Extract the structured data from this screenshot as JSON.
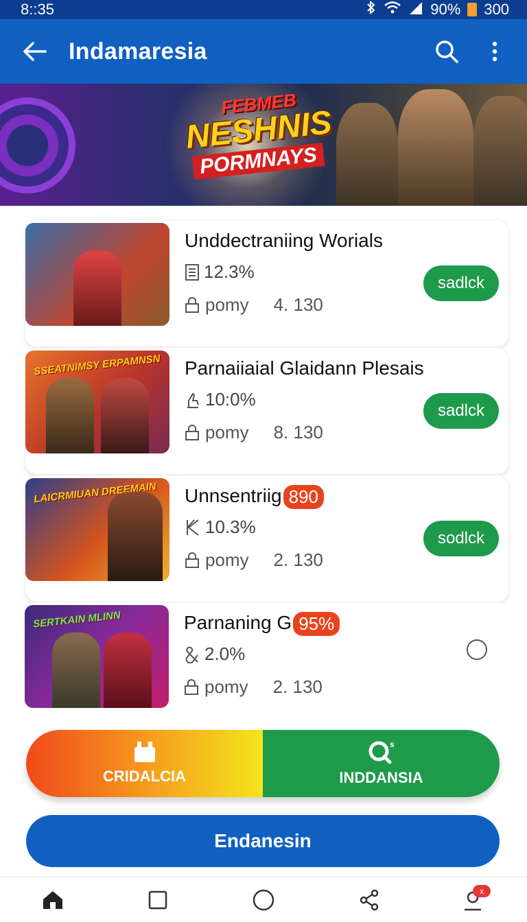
{
  "status_bar": {
    "time": "8::35",
    "battery": "90%",
    "extra": "300"
  },
  "app_bar": {
    "title": "Indamaresia"
  },
  "banner": {
    "line1": "FEBMEB",
    "line2": "NESHNIS",
    "line3": "PORMNAYS"
  },
  "games": [
    {
      "title": "Unddectraniing Worials",
      "badge": "",
      "stat": "12.3%",
      "stat_icon": "document-icon",
      "meta_label": "pomy",
      "meta_value": "4. 130",
      "action": "sadlck",
      "thumb_caption": "",
      "thumb_colors": [
        "#3a6ea8",
        "#c0462f"
      ]
    },
    {
      "title": "Parnaiiaial Glaidann Plesais",
      "badge": "",
      "stat": "10:0%",
      "stat_icon": "hand-icon",
      "meta_label": "pomy",
      "meta_value": "8. 130",
      "action": "sadlck",
      "thumb_caption": "SSEATNIMSY ERPAMNSN",
      "thumb_colors": [
        "#e8732a",
        "#7a2a55"
      ]
    },
    {
      "title": "Unnsentriig",
      "badge": "890",
      "stat": "10.3%",
      "stat_icon": "k-icon",
      "meta_label": "pomy",
      "meta_value": "2. 130",
      "action": "sodlck",
      "thumb_caption": "LAICRMIUAN DREEMAIN",
      "thumb_colors": [
        "#2f3f8a",
        "#d5541e"
      ]
    },
    {
      "title": "Parnaning G",
      "badge": "95%",
      "stat": "2.0%",
      "stat_icon": "ampersand-icon",
      "meta_label": "pomy",
      "meta_value": "2. 130",
      "action": "",
      "thumb_caption": "SERTKAIN MLINN",
      "thumb_colors": [
        "#3c2a7a",
        "#c21e6a"
      ]
    }
  ],
  "dual_button": {
    "left_label": "CRIDALCIA",
    "right_label": "INDDANSIA"
  },
  "primary_button": {
    "label": "Endanesin"
  },
  "nav": {
    "badge": "x"
  }
}
